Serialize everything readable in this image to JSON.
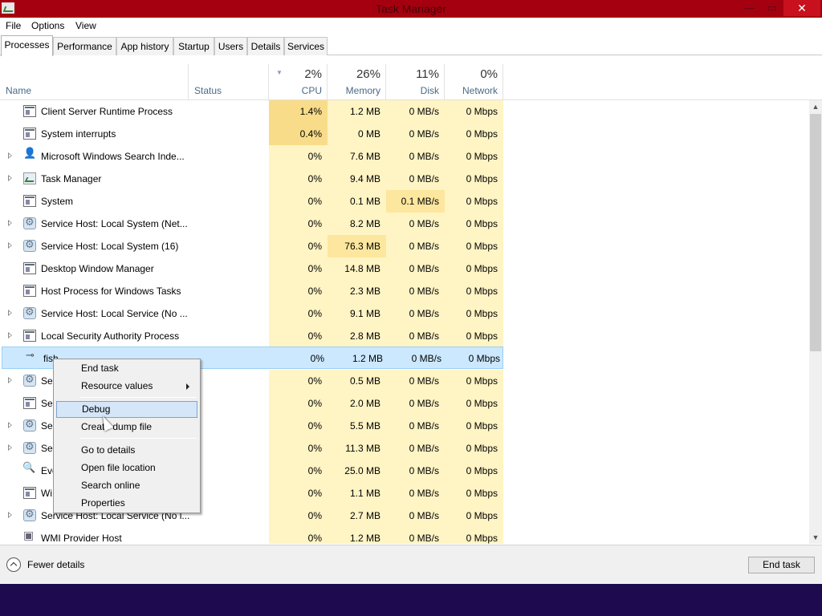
{
  "window": {
    "title": "Task Manager",
    "controls": {
      "minimize": "—",
      "maximize": "▭",
      "close": "✕"
    }
  },
  "menu": [
    "File",
    "Options",
    "View"
  ],
  "tabs": [
    "Processes",
    "Performance",
    "App history",
    "Startup",
    "Users",
    "Details",
    "Services"
  ],
  "active_tab": "Processes",
  "columns": {
    "name": "Name",
    "status": "Status",
    "cpu": {
      "pct": "2%",
      "label": "CPU"
    },
    "memory": {
      "pct": "26%",
      "label": "Memory"
    },
    "disk": {
      "pct": "11%",
      "label": "Disk"
    },
    "network": {
      "pct": "0%",
      "label": "Network"
    }
  },
  "processes": [
    {
      "name": "Client Server Runtime Process",
      "icon": "window-icon",
      "expand": false,
      "cpu": "1.4%",
      "mem": "1.2 MB",
      "disk": "0 MB/s",
      "net": "0 Mbps"
    },
    {
      "name": "System interrupts",
      "icon": "window-icon",
      "expand": false,
      "cpu": "0.4%",
      "mem": "0 MB",
      "disk": "0 MB/s",
      "net": "0 Mbps"
    },
    {
      "name": "Microsoft Windows Search Inde...",
      "icon": "search-user-icon",
      "expand": true,
      "cpu": "0%",
      "mem": "7.6 MB",
      "disk": "0 MB/s",
      "net": "0 Mbps"
    },
    {
      "name": "Task Manager",
      "icon": "task-manager-icon",
      "expand": true,
      "cpu": "0%",
      "mem": "9.4 MB",
      "disk": "0 MB/s",
      "net": "0 Mbps"
    },
    {
      "name": "System",
      "icon": "window-icon",
      "expand": false,
      "cpu": "0%",
      "mem": "0.1 MB",
      "disk": "0.1 MB/s",
      "net": "0 Mbps"
    },
    {
      "name": "Service Host: Local System (Net...",
      "icon": "gear-icon",
      "expand": true,
      "cpu": "0%",
      "mem": "8.2 MB",
      "disk": "0 MB/s",
      "net": "0 Mbps"
    },
    {
      "name": "Service Host: Local System (16)",
      "icon": "gear-icon",
      "expand": true,
      "cpu": "0%",
      "mem": "76.3 MB",
      "disk": "0 MB/s",
      "net": "0 Mbps"
    },
    {
      "name": "Desktop Window Manager",
      "icon": "window-icon",
      "expand": false,
      "cpu": "0%",
      "mem": "14.8 MB",
      "disk": "0 MB/s",
      "net": "0 Mbps"
    },
    {
      "name": "Host Process for Windows Tasks",
      "icon": "window-icon",
      "expand": false,
      "cpu": "0%",
      "mem": "2.3 MB",
      "disk": "0 MB/s",
      "net": "0 Mbps"
    },
    {
      "name": "Service Host: Local Service (No ...",
      "icon": "gear-icon",
      "expand": true,
      "cpu": "0%",
      "mem": "9.1 MB",
      "disk": "0 MB/s",
      "net": "0 Mbps"
    },
    {
      "name": "Local Security Authority Process",
      "icon": "window-icon",
      "expand": true,
      "cpu": "0%",
      "mem": "2.8 MB",
      "disk": "0 MB/s",
      "net": "0 Mbps"
    },
    {
      "name": "fish",
      "icon": "fish-icon",
      "expand": false,
      "selected": true,
      "cpu": "0%",
      "mem": "1.2 MB",
      "disk": "0 MB/s",
      "net": "0 Mbps"
    },
    {
      "name": "Ser",
      "icon": "gear-icon",
      "expand": true,
      "cpu": "0%",
      "mem": "0.5 MB",
      "disk": "0 MB/s",
      "net": "0 Mbps"
    },
    {
      "name": "Ser",
      "icon": "window-icon",
      "expand": false,
      "cpu": "0%",
      "mem": "2.0 MB",
      "disk": "0 MB/s",
      "net": "0 Mbps"
    },
    {
      "name": "Ser",
      "icon": "gear-icon",
      "expand": true,
      "cpu": "0%",
      "mem": "5.5 MB",
      "disk": "0 MB/s",
      "net": "0 Mbps"
    },
    {
      "name": "Ser",
      "icon": "gear-icon",
      "expand": true,
      "cpu": "0%",
      "mem": "11.3 MB",
      "disk": "0 MB/s",
      "net": "0 Mbps"
    },
    {
      "name": "Eve",
      "icon": "event-viewer-icon",
      "expand": false,
      "cpu": "0%",
      "mem": "25.0 MB",
      "disk": "0 MB/s",
      "net": "0 Mbps"
    },
    {
      "name": "Wi",
      "icon": "window-icon",
      "expand": false,
      "cpu": "0%",
      "mem": "1.1 MB",
      "disk": "0 MB/s",
      "net": "0 Mbps"
    },
    {
      "name": "Service Host: Local Service (No l...",
      "icon": "gear-icon",
      "expand": true,
      "cpu": "0%",
      "mem": "2.7 MB",
      "disk": "0 MB/s",
      "net": "0 Mbps"
    },
    {
      "name": "WMI Provider Host",
      "icon": "wmi-icon",
      "expand": false,
      "cpu": "0%",
      "mem": "1.2 MB",
      "disk": "0 MB/s",
      "net": "0 Mbps"
    }
  ],
  "context_menu": {
    "items": [
      "End task",
      "Resource values",
      "Debug",
      "Create dump file",
      "Go to details",
      "Open file location",
      "Search online",
      "Properties"
    ],
    "highlighted": "Debug"
  },
  "footer": {
    "fewer_details": "Fewer details",
    "end_task": "End task"
  },
  "colors": {
    "titlebar": "#a50010",
    "heat_light": "#fff4c4",
    "heat_mid": "#fde79e",
    "selection": "#cce8ff",
    "taskbar": "#1e0a4e"
  }
}
